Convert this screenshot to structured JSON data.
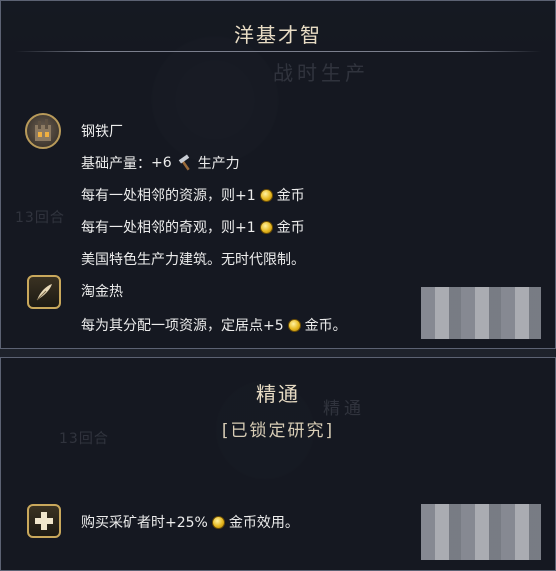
{
  "top_panel": {
    "title": "洋基才智",
    "ghost_label": "战时生产",
    "ghost_turns": "13回合",
    "building": {
      "name": "钢铁厂",
      "base_yield_label": "基础产量：",
      "base_yield_value": "+6",
      "base_yield_unit": "生产力",
      "line_resource_prefix": "每有一处相邻的资源，则+1",
      "line_resource_suffix": "金币",
      "line_wonder_prefix": "每有一处相邻的奇观，则+1",
      "line_wonder_suffix": "金币",
      "unique_note": "美国特色生产力建筑。无时代限制。"
    },
    "policy": {
      "name": "淘金热",
      "desc_prefix": "每为其分配一项资源，定居点+5",
      "desc_suffix": "金币。"
    }
  },
  "bottom_panel": {
    "title": "精通",
    "ghost_label": "精通",
    "ghost_turns": "13回合",
    "locked_label": "[已锁定研究]",
    "bonus_prefix": "购买采矿者时+25%",
    "bonus_suffix": "金币效用。"
  },
  "icons": {
    "steel_mill": "steel-mill-icon",
    "production": "hammer-icon",
    "gold": "gold-coin-icon",
    "policy": "feather-quill-icon",
    "mastery": "plus-icon"
  }
}
